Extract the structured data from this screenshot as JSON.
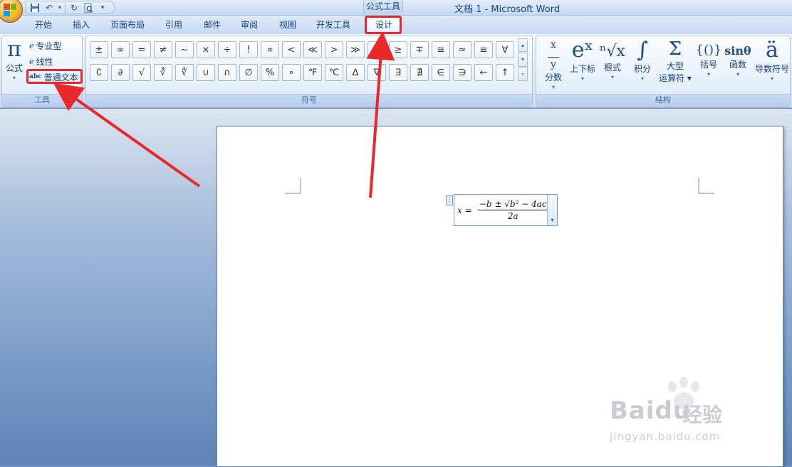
{
  "window": {
    "title": "文档 1 - Microsoft Word",
    "context_tab_group": "公式工具"
  },
  "tabs": [
    "开始",
    "插入",
    "页面布局",
    "引用",
    "邮件",
    "审阅",
    "视图",
    "开发工具",
    "设计"
  ],
  "active_tab": "设计",
  "ribbon": {
    "tools": {
      "label": "工具",
      "equation_label": "公式",
      "items": [
        {
          "icon": "e",
          "label": "专业型"
        },
        {
          "icon": "e",
          "label": "线性"
        },
        {
          "icon": "abc",
          "label": "普通文本"
        }
      ]
    },
    "symbols": {
      "label": "符号",
      "row1": [
        "±",
        "∞",
        "=",
        "≠",
        "~",
        "×",
        "÷",
        "!",
        "∝",
        "<",
        "≪",
        ">",
        "≫",
        "≤",
        "≥",
        "∓",
        "≅",
        "≈",
        "≡",
        "∀"
      ],
      "row2": [
        "∁",
        "∂",
        "√",
        "∛",
        "∜",
        "∪",
        "∩",
        "∅",
        "%",
        "∘",
        "℉",
        "℃",
        "∆",
        "∇",
        "∃",
        "∄",
        "∈",
        "∋",
        "←",
        "↑"
      ]
    },
    "structures": {
      "label": "结构",
      "items": [
        {
          "glyph": "x/y",
          "label": "分数"
        },
        {
          "glyph": "eˣ",
          "label": "上下标"
        },
        {
          "glyph": "ⁿ√x",
          "label": "根式"
        },
        {
          "glyph": "∫",
          "label": "积分"
        },
        {
          "glyph": "Σ",
          "label": "大型",
          "label2": "运算符"
        },
        {
          "glyph": "{()}",
          "label": "括号"
        },
        {
          "glyph": "sinθ",
          "label": "函数"
        },
        {
          "glyph": "ä",
          "label": "导数符号"
        }
      ]
    }
  },
  "equation": {
    "lhs": "x",
    "equals": "=",
    "numerator": "−b ± √b² − 4ac",
    "denominator": "2a"
  },
  "watermark": {
    "brand": "Baidu",
    "cn": "经验",
    "url": "jingyan.baidu.com"
  },
  "colors": {
    "highlight": "#e8282b",
    "ribbon_text": "#15428b"
  }
}
